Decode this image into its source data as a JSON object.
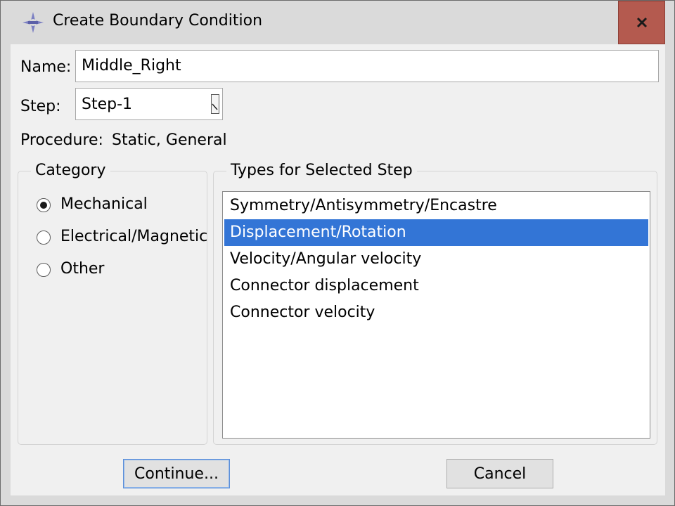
{
  "window": {
    "title": "Create Boundary Condition",
    "icon": "abaqus-compass-icon",
    "close_label": "x"
  },
  "form": {
    "name_label": "Name:",
    "name_value": "Middle_Right",
    "step_label": "Step:",
    "step_value": "Step-1",
    "procedure_label": "Procedure:",
    "procedure_value": "Static, General"
  },
  "category": {
    "title": "Category",
    "options": [
      {
        "label": "Mechanical",
        "selected": true
      },
      {
        "label": "Electrical/Magnetic",
        "selected": false
      },
      {
        "label": "Other",
        "selected": false
      }
    ]
  },
  "types": {
    "title": "Types for Selected Step",
    "items": [
      {
        "label": "Symmetry/Antisymmetry/Encastre",
        "selected": false
      },
      {
        "label": "Displacement/Rotation",
        "selected": true
      },
      {
        "label": "Velocity/Angular velocity",
        "selected": false
      },
      {
        "label": "Connector displacement",
        "selected": false
      },
      {
        "label": "Connector velocity",
        "selected": false
      }
    ]
  },
  "buttons": {
    "continue": "Continue...",
    "cancel": "Cancel"
  },
  "colors": {
    "selection": "#3375d6",
    "close_button": "#b45a4f",
    "titlebar": "#dadada"
  }
}
